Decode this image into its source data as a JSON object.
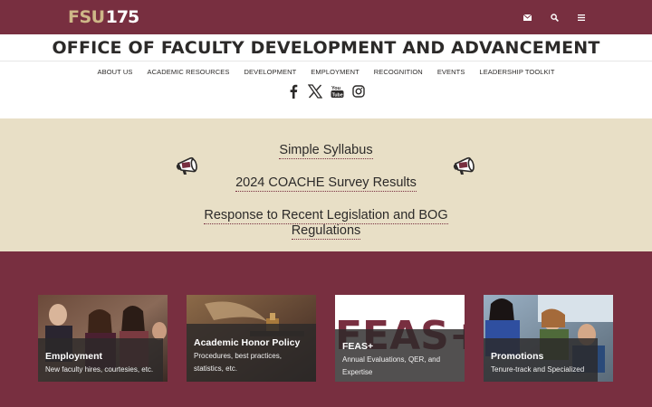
{
  "header": {
    "logo_fsu": "FSU",
    "logo_number": "175",
    "icons": [
      "envelope-icon",
      "search-icon",
      "menu-icon"
    ],
    "brand_color": "#782f40",
    "gold_color": "#ceb888"
  },
  "site_title": "OFFICE OF FACULTY DEVELOPMENT AND ADVANCEMENT",
  "nav": {
    "items": [
      {
        "label": "ABOUT US"
      },
      {
        "label": "ACADEMIC RESOURCES"
      },
      {
        "label": "DEVELOPMENT"
      },
      {
        "label": "EMPLOYMENT"
      },
      {
        "label": "RECOGNITION"
      },
      {
        "label": "EVENTS"
      },
      {
        "label": "LEADERSHIP TOOLKIT"
      }
    ]
  },
  "social": [
    "facebook-icon",
    "x-icon",
    "youtube-icon",
    "instagram-icon"
  ],
  "announcements": {
    "background": "#e8dfc6",
    "links": [
      {
        "label": "Simple Syllabus"
      },
      {
        "label": "2024 COACHE Survey Results"
      },
      {
        "label_line1": "Response to Recent Legislation and BOG",
        "label_line2": "Regulations"
      }
    ]
  },
  "cards": [
    {
      "title": "Employment",
      "subtitle": "New faculty hires, courtesies, etc."
    },
    {
      "title": "Academic Honor Policy",
      "subtitle_line1": "Procedures, best practices,",
      "subtitle_line2": "statistics, etc."
    },
    {
      "title": "FEAS+",
      "image_text": "FEAS+",
      "subtitle_line1": "Annual Evaluations, QER, and",
      "subtitle_line2": "Expertise"
    },
    {
      "title": "Promotions",
      "subtitle": "Tenure-track and Specialized"
    }
  ]
}
